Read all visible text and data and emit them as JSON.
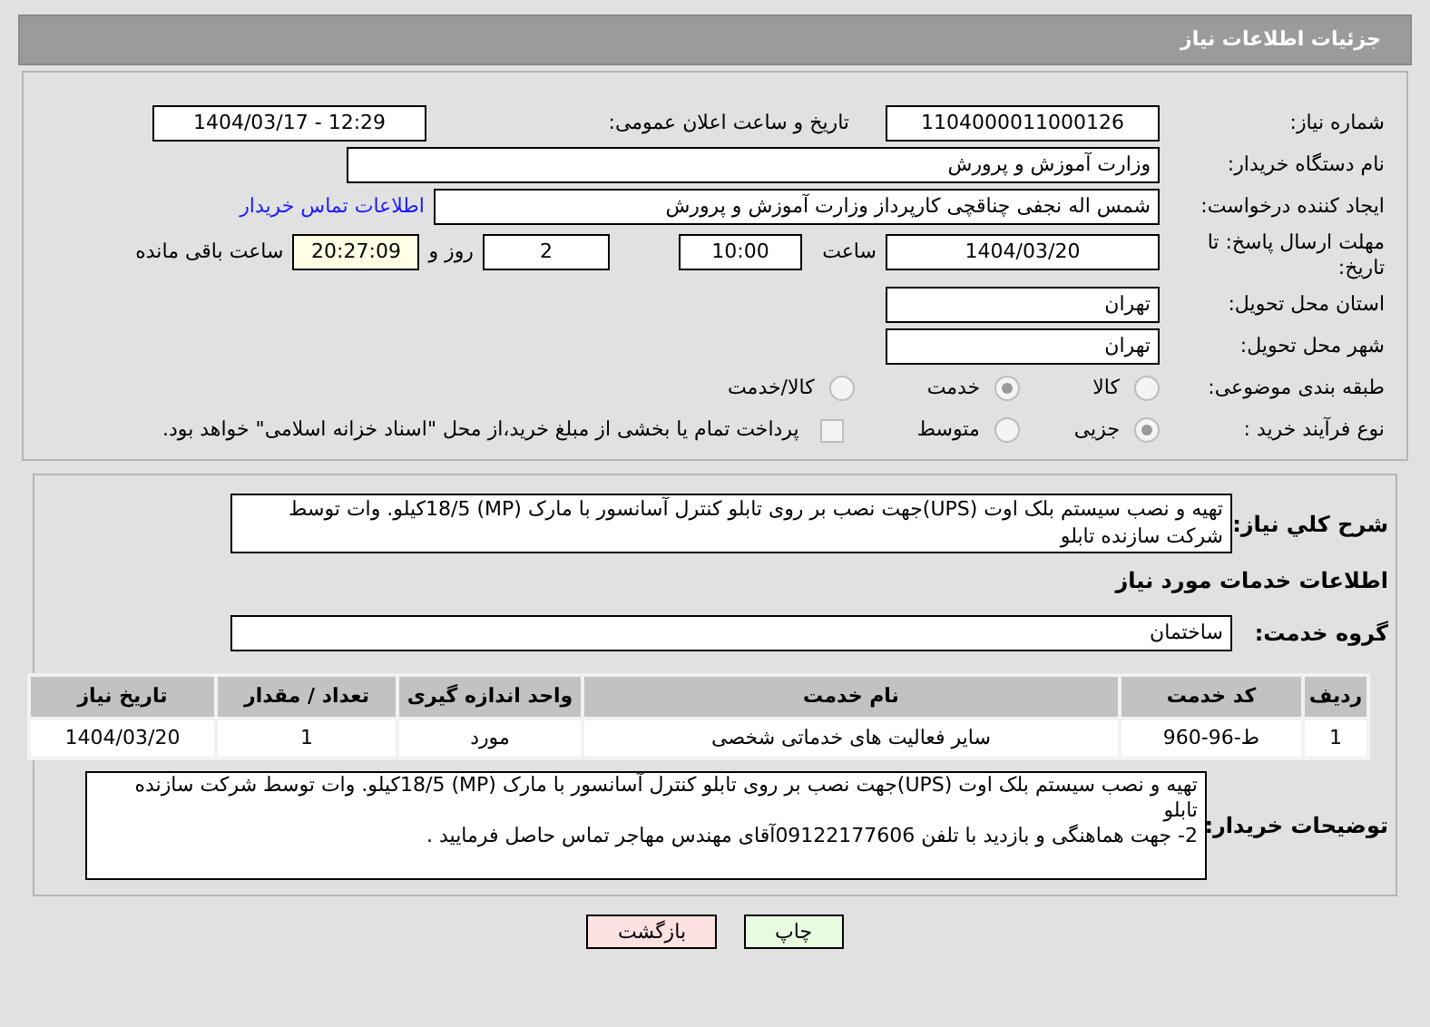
{
  "header": {
    "title": "جزئیات اطلاعات نیاز"
  },
  "details": {
    "need_number": {
      "label": "شماره نیاز:",
      "value": "1104000011000126"
    },
    "announce": {
      "label": "تاریخ و ساعت اعلان عمومی:",
      "value": "1404/03/17 - 12:29"
    },
    "buyer": {
      "label": "نام دستگاه خریدار:",
      "value": "وزارت آموزش و پرورش"
    },
    "requester": {
      "label": "ایجاد کننده درخواست:",
      "value": "شمس اله نجفی چناقچی کارپرداز وزارت آموزش و پرورش",
      "link": "اطلاعات تماس خریدار"
    },
    "deadline": {
      "label": "مهلت ارسال پاسخ: تا تاریخ:",
      "date": "1404/03/20",
      "time_label": "ساعت",
      "time": "10:00",
      "days": "2",
      "days_label": "روز و",
      "remaining": "20:27:09",
      "remaining_label": "ساعت باقی مانده"
    },
    "province": {
      "label": "استان محل تحویل:",
      "value": "تهران"
    },
    "city": {
      "label": "شهر محل تحویل:",
      "value": "تهران"
    },
    "category": {
      "label": "طبقه بندی موضوعی:",
      "options": [
        {
          "label": "کالا",
          "selected": false
        },
        {
          "label": "خدمت",
          "selected": true
        },
        {
          "label": "کالا/خدمت",
          "selected": false
        }
      ]
    },
    "process": {
      "label": "نوع فرآیند خرید :",
      "options": [
        {
          "label": "جزیی",
          "selected": true
        },
        {
          "label": "متوسط",
          "selected": false
        }
      ],
      "payment": {
        "checked": false,
        "text": "پرداخت تمام یا بخشی از مبلغ خرید،از محل \"اسناد خزانه اسلامی\" خواهد بود."
      }
    }
  },
  "services": {
    "description": {
      "label": "شرح کلي نياز:",
      "value": "تهیه و نصب سیستم بلک اوت (UPS)جهت نصب بر روی تابلو کنترل آسانسور با مارک (MP) 18/5کیلو. وات توسط شرکت سازنده تابلو"
    },
    "section_title": "اطلاعات خدمات مورد نیاز",
    "group": {
      "label": "گروه خدمت:",
      "value": "ساختمان"
    },
    "table": {
      "columns": [
        "ردیف",
        "کد خدمت",
        "نام خدمت",
        "واحد اندازه گیری",
        "تعداد / مقدار",
        "تاریخ نیاز"
      ],
      "rows": [
        [
          "1",
          "ط-96-960",
          "سایر فعالیت های خدماتی شخصی",
          "مورد",
          "1",
          "1404/03/20"
        ]
      ]
    },
    "notes": {
      "label": "توضیحات خریدار:",
      "lines": [
        "تهیه و نصب سیستم بلک اوت (UPS)جهت نصب بر روی تابلو کنترل آسانسور با مارک (MP) 18/5کیلو. وات توسط شرکت سازنده  تابلو",
        "2- جهت هماهنگی و بازدید با تلفن 09122177606آقای مهندس مهاجر تماس حاصل فرمایید ."
      ]
    }
  },
  "buttons": [
    {
      "label": "چاپ",
      "kind": "print"
    },
    {
      "label": "بازگشت",
      "kind": "back"
    }
  ]
}
